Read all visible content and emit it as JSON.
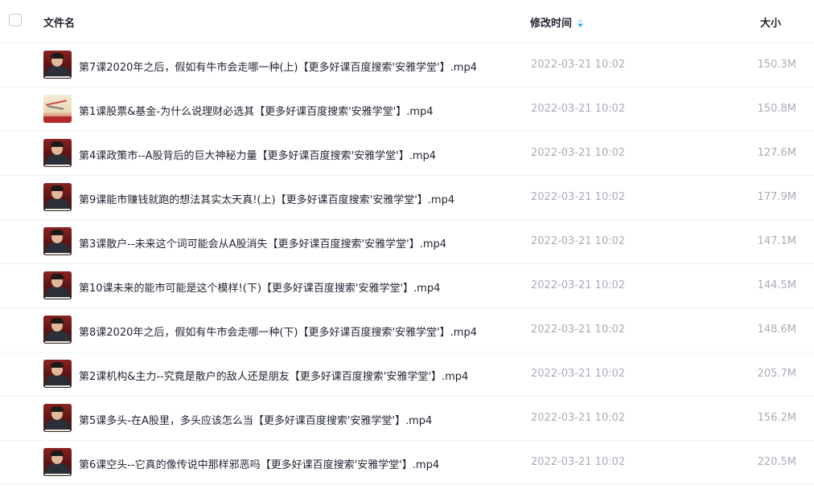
{
  "header": {
    "name_label": "文件名",
    "time_label": "修改时间",
    "size_label": "大小",
    "sort_icon": "sort-icon",
    "accent": "#36a3f7"
  },
  "files": [
    {
      "name": "第7课2020年之后，假如有牛市会走哪一种(上)【更多好课百度搜索'安雅学堂'】.mp4",
      "time": "2022-03-21 10:02",
      "size": "150.3M",
      "thumb": "video-thumbnail"
    },
    {
      "name": "第1课股票&基金-为什么说理财必选其【更多好课百度搜索'安雅学堂'】.mp4",
      "time": "2022-03-21 10:02",
      "size": "150.8M",
      "thumb": "video-thumbnail-chart"
    },
    {
      "name": "第4课政策市--A股背后的巨大神秘力量【更多好课百度搜索'安雅学堂'】.mp4",
      "time": "2022-03-21 10:02",
      "size": "127.6M",
      "thumb": "video-thumbnail"
    },
    {
      "name": "第9课能市赚钱就跑的想法其实太天真!(上)【更多好课百度搜索'安雅学堂'】.mp4",
      "time": "2022-03-21 10:02",
      "size": "177.9M",
      "thumb": "video-thumbnail"
    },
    {
      "name": "第3课散户--未来这个词可能会从A股消失【更多好课百度搜索'安雅学堂'】.mp4",
      "time": "2022-03-21 10:02",
      "size": "147.1M",
      "thumb": "video-thumbnail"
    },
    {
      "name": "第10课未来的能市可能是这个模样!(下)【更多好课百度搜索'安雅学堂'】.mp4",
      "time": "2022-03-21 10:02",
      "size": "144.5M",
      "thumb": "video-thumbnail"
    },
    {
      "name": "第8课2020年之后，假如有牛市会走哪一种(下)【更多好课百度搜索'安雅学堂'】.mp4",
      "time": "2022-03-21 10:02",
      "size": "148.6M",
      "thumb": "video-thumbnail"
    },
    {
      "name": "第2课机构&主力--究竟是散户的敌人还是朋友【更多好课百度搜索'安雅学堂'】.mp4",
      "time": "2022-03-21 10:02",
      "size": "205.7M",
      "thumb": "video-thumbnail"
    },
    {
      "name": "第5课多头-在A股里，多头应该怎么当【更多好课百度搜索'安雅学堂'】.mp4",
      "time": "2022-03-21 10:02",
      "size": "156.2M",
      "thumb": "video-thumbnail"
    },
    {
      "name": "第6课空头--它真的像传说中那样邪恶吗【更多好课百度搜索'安雅学堂'】.mp4",
      "time": "2022-03-21 10:02",
      "size": "220.5M",
      "thumb": "video-thumbnail"
    }
  ]
}
